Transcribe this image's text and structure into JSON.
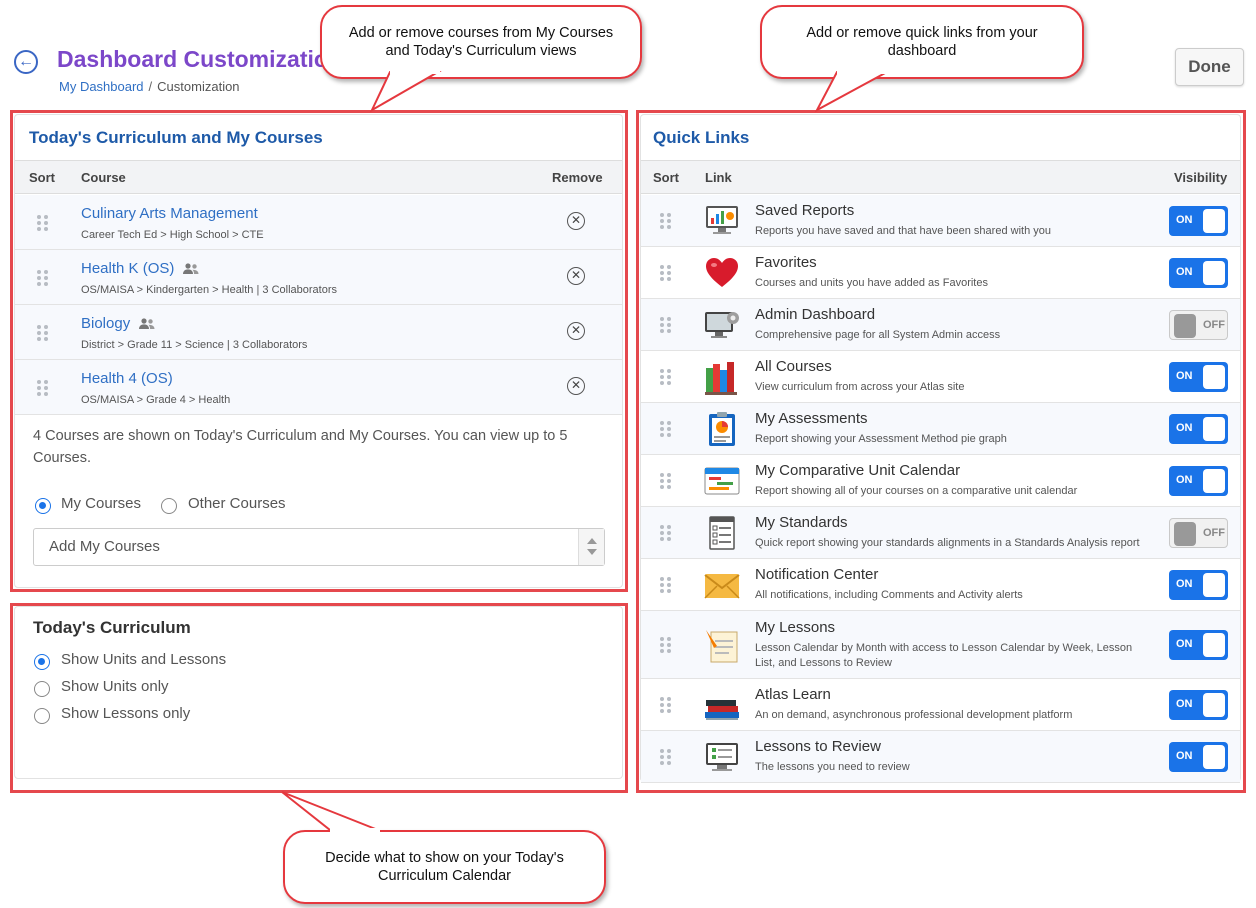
{
  "header": {
    "title": "Dashboard Customization",
    "breadcrumb": {
      "home": "My Dashboard",
      "current": "Customization"
    },
    "done_label": "Done"
  },
  "callouts": {
    "courses": "Add or remove courses from My Courses and Today's Curriculum views",
    "quick_links": "Add or remove quick links from your dashboard",
    "calendar": "Decide what to show on your Today's Curriculum Calendar"
  },
  "courses_panel": {
    "title": "Today's Curriculum and My Courses",
    "columns": {
      "sort": "Sort",
      "course": "Course",
      "remove": "Remove"
    },
    "courses": [
      {
        "name": "Culinary Arts Management",
        "path": "Career Tech Ed > High School > CTE",
        "shared": false
      },
      {
        "name": "Health K (OS)",
        "path": "OS/MAISA > Kindergarten > Health | 3 Collaborators",
        "shared": true
      },
      {
        "name": "Biology",
        "path": "District > Grade 11 > Science | 3 Collaborators",
        "shared": true
      },
      {
        "name": "Health 4 (OS)",
        "path": "OS/MAISA > Grade 4 > Health",
        "shared": false
      }
    ],
    "info": "4 Courses are shown on Today's Curriculum and My Courses. You can view up to 5 Courses.",
    "source_options": {
      "my_courses": "My Courses",
      "other_courses": "Other Courses",
      "selected": "my_courses"
    },
    "add_select_value": "Add My Courses"
  },
  "todays_curriculum": {
    "title": "Today's Curriculum",
    "options": [
      "Show Units and Lessons",
      "Show Units only",
      "Show Lessons only"
    ],
    "selected_index": 0
  },
  "quick_links": {
    "title": "Quick Links",
    "columns": {
      "sort": "Sort",
      "link": "Link",
      "visibility": "Visibility"
    },
    "toggle_labels": {
      "on": "ON",
      "off": "OFF"
    },
    "items": [
      {
        "name": "Saved Reports",
        "desc": "Reports you have saved and that have been shared with you",
        "visible": true,
        "icon": "saved-reports-icon"
      },
      {
        "name": "Favorites",
        "desc": "Courses and units you have added as Favorites",
        "visible": true,
        "icon": "heart-icon"
      },
      {
        "name": "Admin Dashboard",
        "desc": "Comprehensive page for all System Admin access",
        "visible": false,
        "icon": "admin-monitor-icon"
      },
      {
        "name": "All Courses",
        "desc": "View curriculum from across your Atlas site",
        "visible": true,
        "icon": "books-icon"
      },
      {
        "name": "My Assessments",
        "desc": "Report showing your Assessment Method pie graph",
        "visible": true,
        "icon": "assessment-clipboard-icon"
      },
      {
        "name": "My Comparative Unit Calendar",
        "desc": "Report showing all of your courses on a comparative unit calendar",
        "visible": true,
        "icon": "calendar-icon"
      },
      {
        "name": "My Standards",
        "desc": "Quick report showing your standards alignments in a Standards Analysis report",
        "visible": false,
        "icon": "checklist-icon"
      },
      {
        "name": "Notification Center",
        "desc": "All notifications, including Comments and Activity alerts",
        "visible": true,
        "icon": "envelope-icon"
      },
      {
        "name": "My Lessons",
        "desc": "Lesson Calendar by Month with access to Lesson Calendar by Week, Lesson List, and Lessons to Review",
        "visible": true,
        "icon": "lesson-planning-icon"
      },
      {
        "name": "Atlas Learn",
        "desc": "An on demand, asynchronous professional development platform",
        "visible": true,
        "icon": "book-stack-icon"
      },
      {
        "name": "Lessons to Review",
        "desc": "The lessons you need to review",
        "visible": true,
        "icon": "review-monitor-icon"
      }
    ]
  }
}
